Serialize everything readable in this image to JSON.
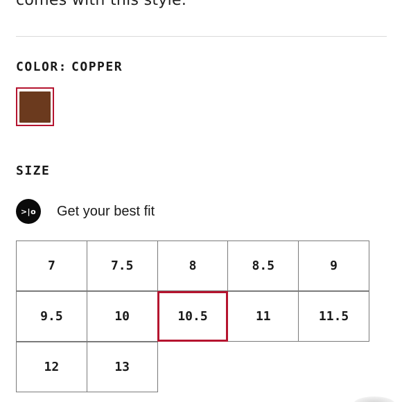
{
  "intro": {
    "text": "comes with this style."
  },
  "color": {
    "label": "COLOR:",
    "value": "COPPER",
    "swatch_hex": "#6b3a1e",
    "selected_border_hex": "#b5142f"
  },
  "size": {
    "heading": "SIZE",
    "fit_icon_text": ">|o",
    "fit_label": "Get your best fit",
    "options": [
      [
        "7",
        "7.5",
        "8",
        "8.5",
        "9"
      ],
      [
        "9.5",
        "10",
        "10.5",
        "11",
        "11.5"
      ],
      [
        "12",
        "13"
      ]
    ],
    "selected": "10.5"
  }
}
